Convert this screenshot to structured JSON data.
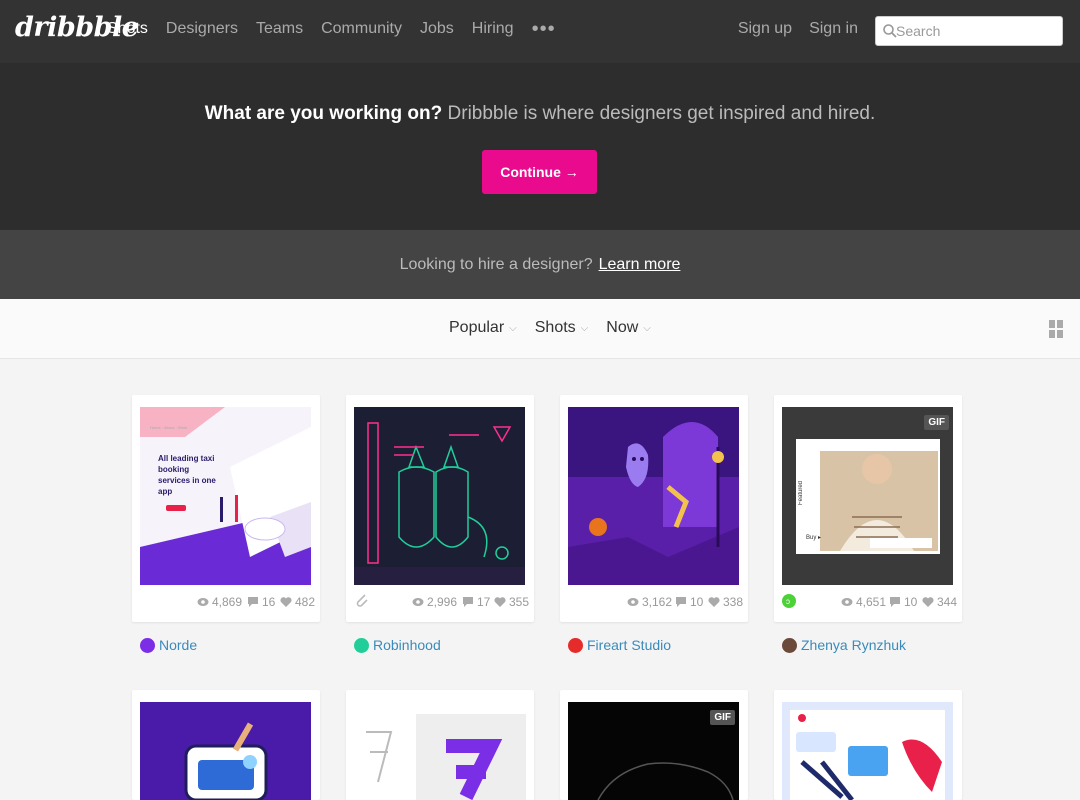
{
  "nav": {
    "logo": "dribbble",
    "links": [
      "Shots",
      "Designers",
      "Teams",
      "Community",
      "Jobs",
      "Hiring"
    ],
    "more": "•••",
    "signup": "Sign up",
    "signin": "Sign in",
    "search_placeholder": "Search"
  },
  "hero": {
    "bold": "What are you working on?",
    "rest": "Dribbble is where designers get inspired and hired.",
    "cta": "Continue →"
  },
  "hire": {
    "text": "Looking to hire a designer?",
    "link": "Learn more"
  },
  "filters": [
    "Popular",
    "Shots",
    "Now"
  ],
  "shots": [
    {
      "author": "Norde",
      "views": "4,869",
      "comments": "16",
      "likes": "482",
      "thumb_text": "All leading taxi booking services in one app",
      "avatar_color": "#7b2ee6"
    },
    {
      "author": "Robinhood",
      "views": "2,996",
      "comments": "17",
      "likes": "355",
      "avatar_color": "#21ce99"
    },
    {
      "author": "Fireart Studio",
      "views": "3,162",
      "comments": "10",
      "likes": "338",
      "avatar_color": "#e62b2b"
    },
    {
      "author": "Zhenya Rynzhuk",
      "views": "4,651",
      "comments": "10",
      "likes": "344",
      "gif": "GIF",
      "thumb_text": "Featured",
      "avatar_color": "#6b4a3a"
    }
  ],
  "row2": [
    {
      "gif": ""
    },
    {
      "gif": ""
    },
    {
      "gif": "GIF"
    },
    {
      "gif": ""
    }
  ],
  "colors": {
    "brand_pink": "#ea0a8e",
    "nav_bg": "#333333",
    "link_blue": "#3a8bbb"
  }
}
